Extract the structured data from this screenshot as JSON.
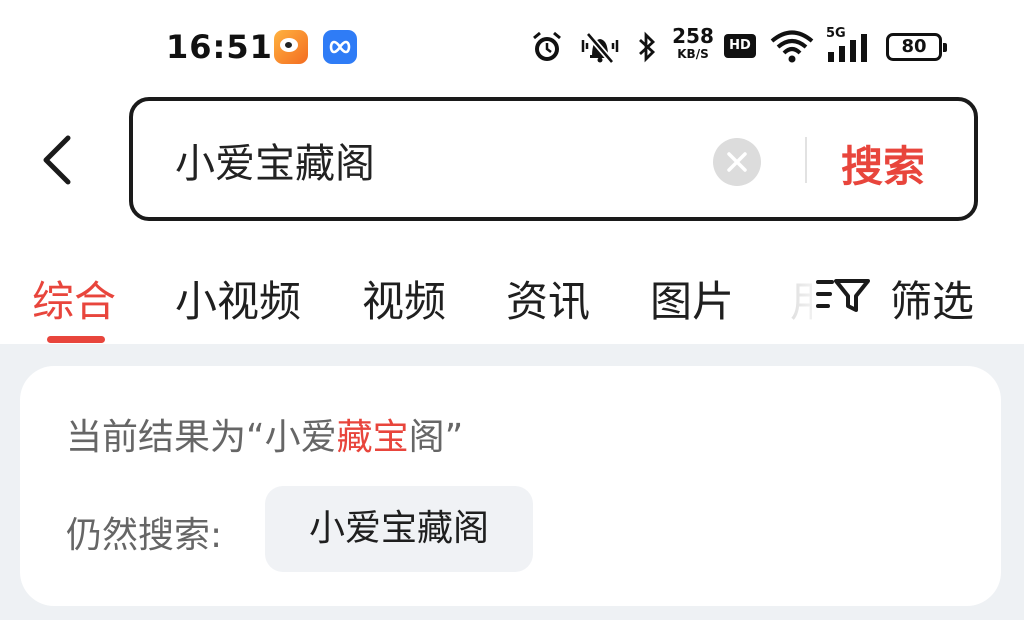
{
  "status_bar": {
    "time": "16:51",
    "net_speed": "258",
    "net_speed_unit": "KB/S",
    "hd_label": "HD",
    "network_type": "5G",
    "battery": "80"
  },
  "search": {
    "query": "小爱宝藏阁",
    "submit_label": "搜索"
  },
  "tabs": [
    {
      "label": "综合",
      "active": true
    },
    {
      "label": "小视频"
    },
    {
      "label": "视频"
    },
    {
      "label": "资讯"
    },
    {
      "label": "图片"
    }
  ],
  "filter_label": "筛选",
  "correction": {
    "prefix": "当前结果为“小爱",
    "highlight": "藏宝",
    "suffix": "阁”"
  },
  "still_search": {
    "label": "仍然搜索:",
    "term": "小爱宝藏阁"
  },
  "colors": {
    "accent": "#e8453c",
    "content_bg": "#eef1f4"
  }
}
